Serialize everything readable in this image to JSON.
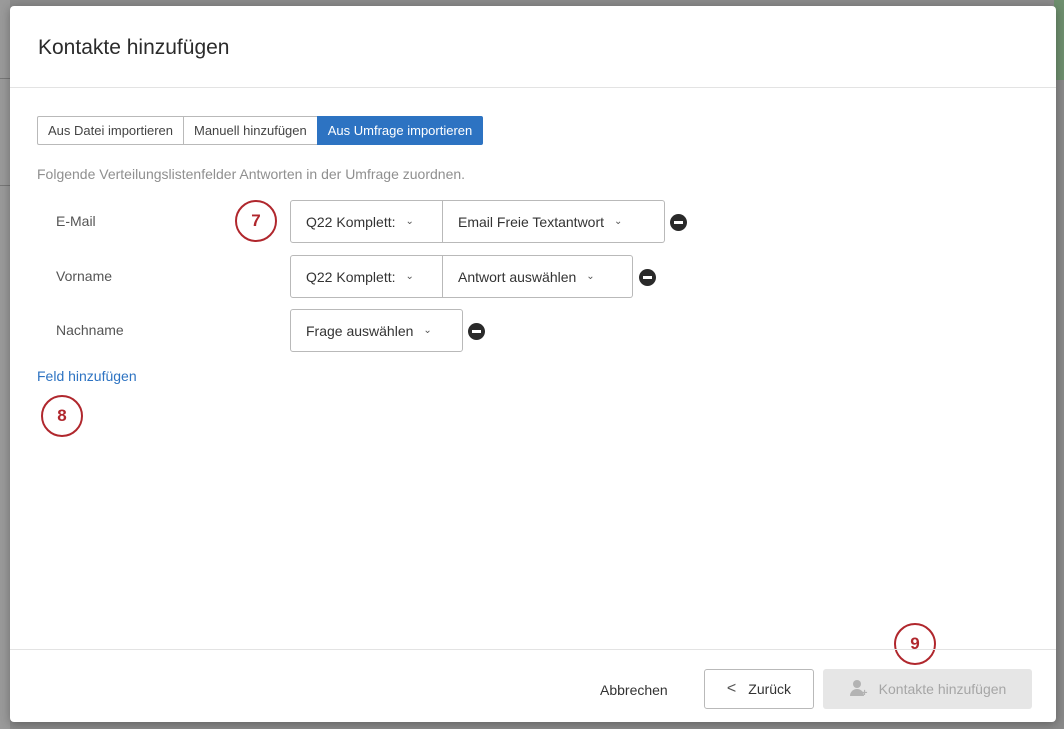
{
  "modal": {
    "title": "Kontakte hinzufügen"
  },
  "tabs": [
    {
      "label": "Aus Datei importieren",
      "active": false
    },
    {
      "label": "Manuell hinzufügen",
      "active": false
    },
    {
      "label": "Aus Umfrage importieren",
      "active": true
    }
  ],
  "instruction": "Folgende Verteilungslistenfelder Antworten in der Umfrage zuordnen.",
  "fields": [
    {
      "label": "E-Mail",
      "question": "Q22 Komplett:",
      "answer": "Email Freie Textantwort"
    },
    {
      "label": "Vorname",
      "question": "Q22 Komplett:",
      "answer": "Antwort auswählen"
    },
    {
      "label": "Nachname",
      "question": "Frage auswählen"
    }
  ],
  "add_field_label": "Feld hinzufügen",
  "callouts": [
    "7",
    "8",
    "9"
  ],
  "footer": {
    "cancel_label": "Abbrechen",
    "back_label": "Zurück",
    "add_label": "Kontakte hinzufügen"
  },
  "colors": {
    "accent": "#2d73c2",
    "callout": "#b0272d",
    "disabled_bg": "#e6e6e6"
  }
}
